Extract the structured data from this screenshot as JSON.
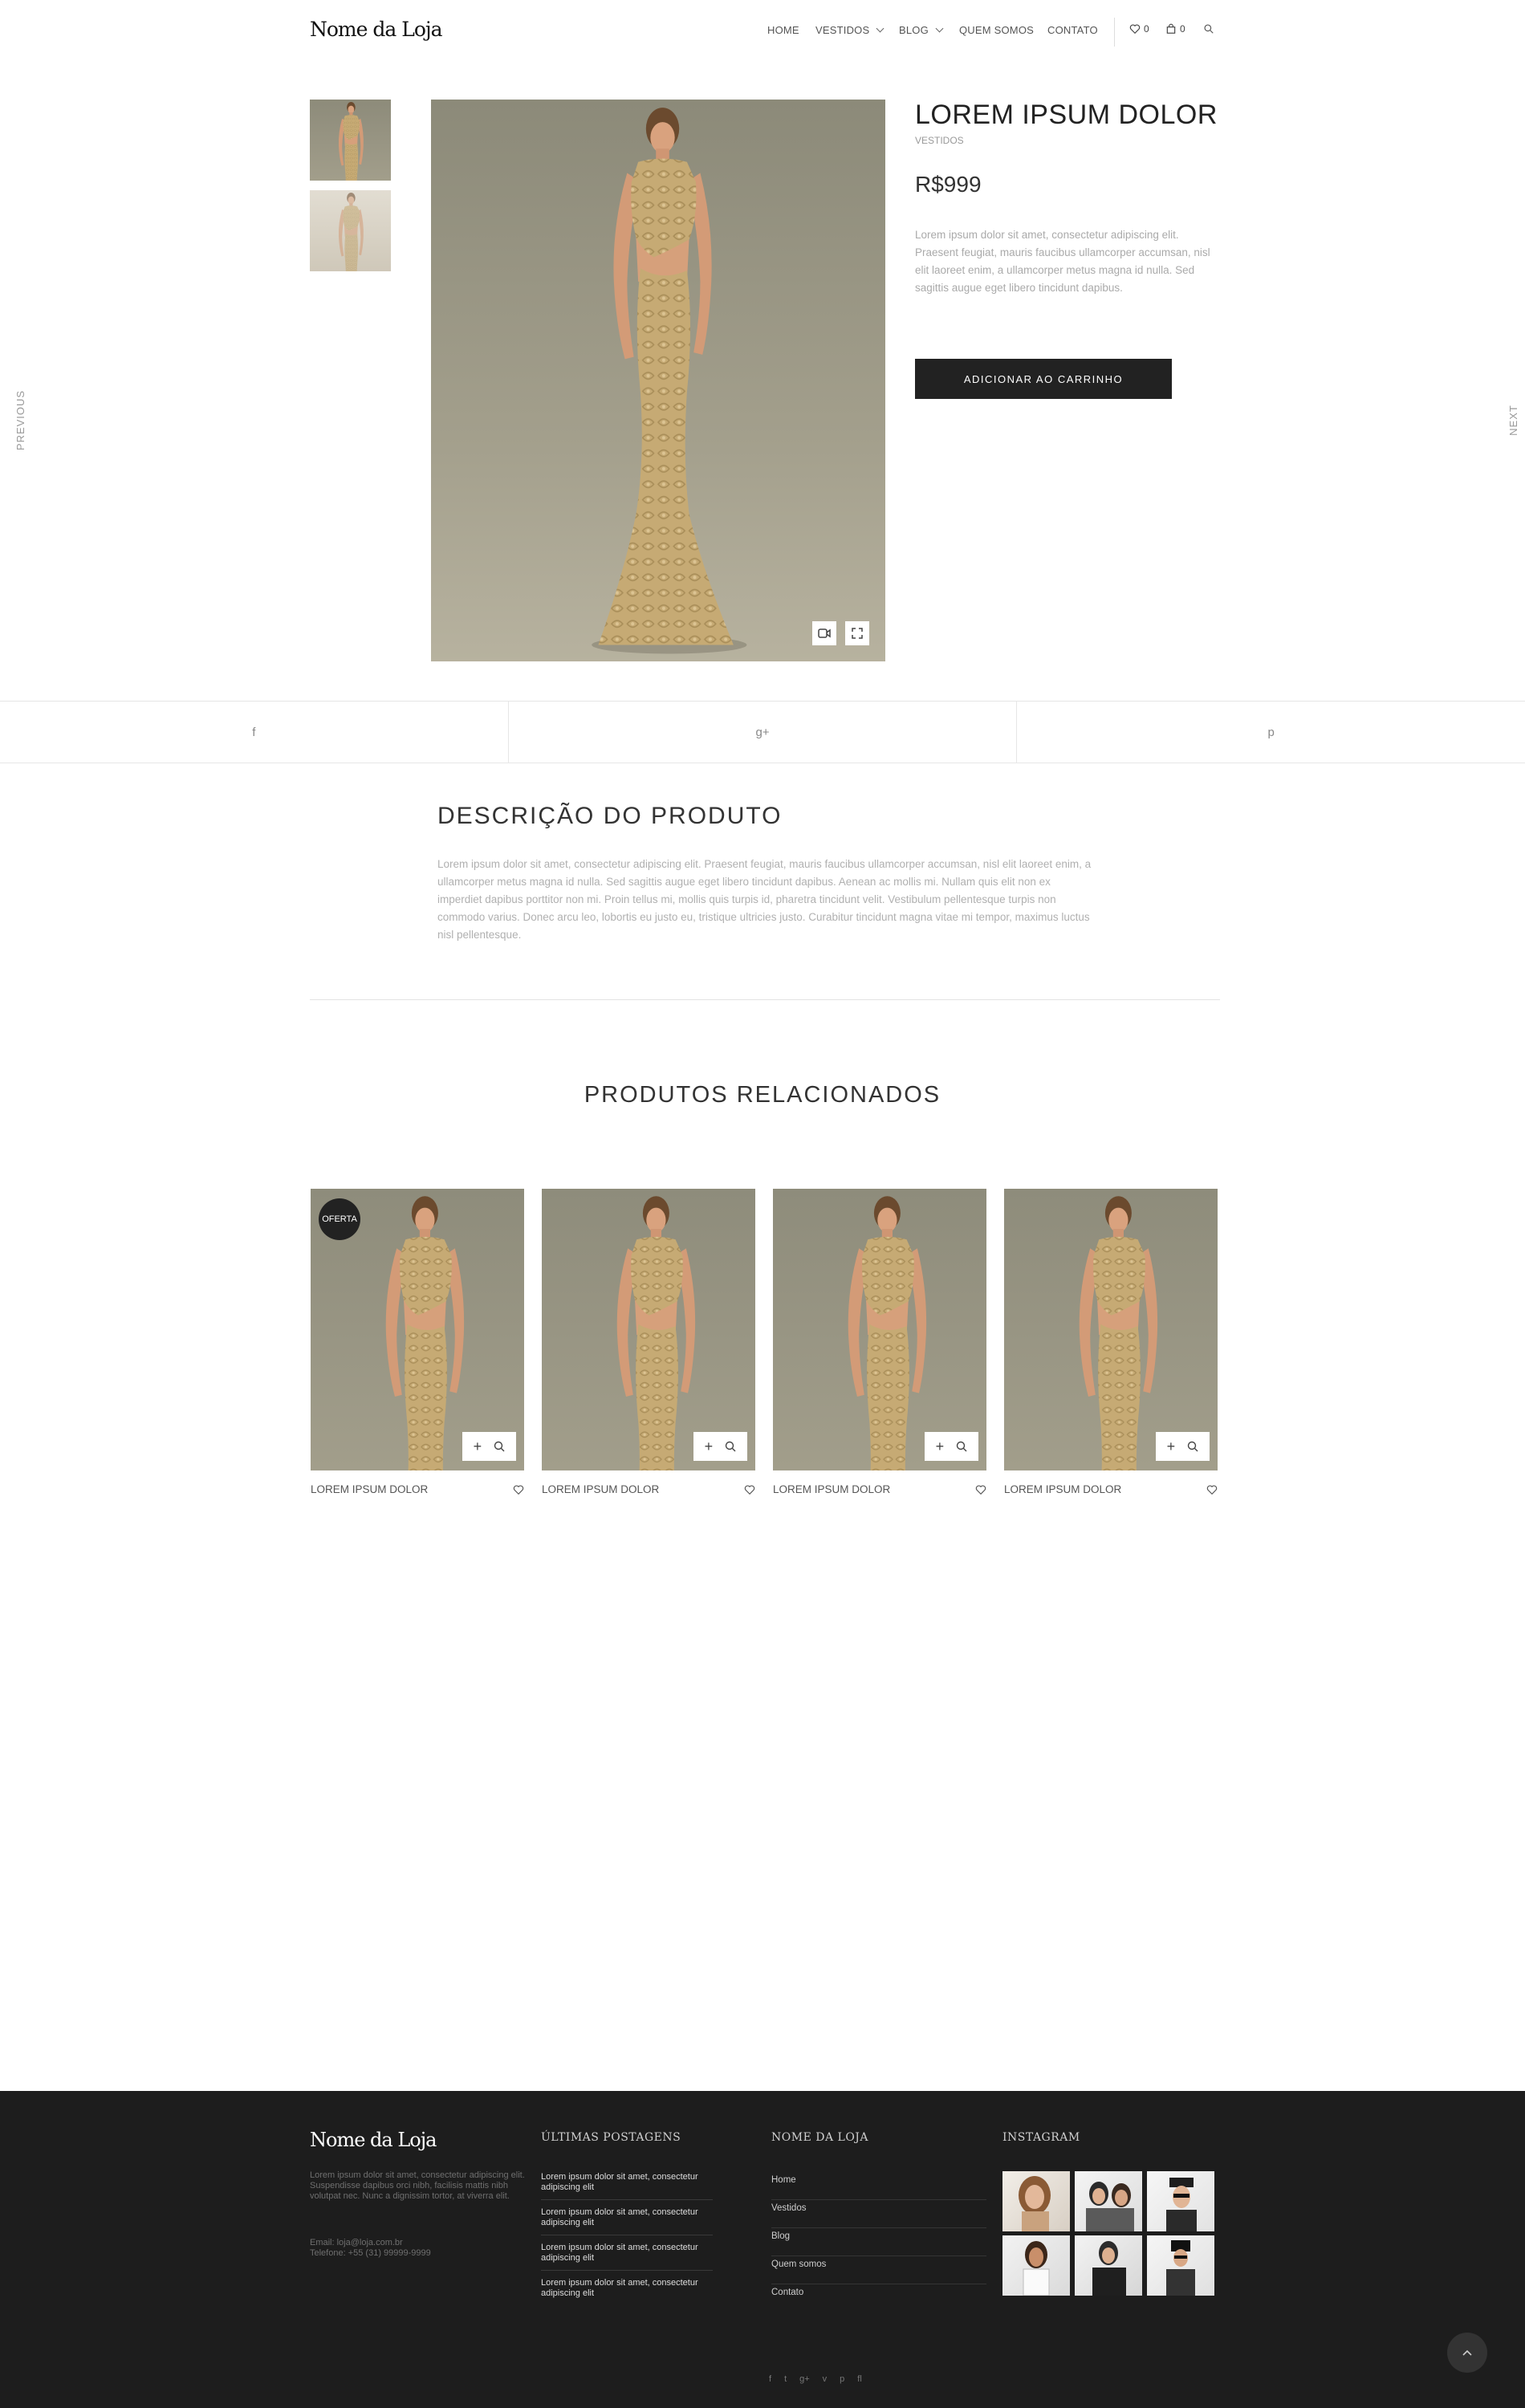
{
  "header": {
    "logo": "Nome da Loja",
    "nav": {
      "home": "HOME",
      "vestidos": "VESTIDOS",
      "blog": "BLOG",
      "quem_somos": "QUEM SOMOS",
      "contato": "CONTATO"
    },
    "wishlist_count": "0",
    "cart_count": "0"
  },
  "side_nav": {
    "previous": "PREVIOUS",
    "next": "NEXT"
  },
  "product": {
    "title": "LOREM IPSUM DOLOR",
    "category": "VESTIDOS",
    "price": "R$999",
    "short_description": "Lorem ipsum dolor sit amet, consectetur adipiscing elit. Praesent feugiat, mauris faucibus ullamcorper accumsan, nisl elit laoreet enim, a ullamcorper metus magna id nulla. Sed sagittis augue eget libero tincidunt dapibus.",
    "add_to_cart": "ADICIONAR AO CARRINHO"
  },
  "share": {
    "facebook": "f",
    "google": "g+",
    "pinterest": "p"
  },
  "description": {
    "title": "DESCRIÇÃO DO PRODUTO",
    "text": "Lorem ipsum dolor sit amet, consectetur adipiscing elit. Praesent feugiat, mauris faucibus ullamcorper accumsan, nisl elit laoreet enim, a ullamcorper metus magna id nulla. Sed sagittis augue eget libero tincidunt dapibus. Aenean ac mollis mi. Nullam quis elit non ex imperdiet dapibus porttitor non mi. Proin tellus mi, mollis quis turpis id, pharetra tincidunt velit. Vestibulum pellentesque turpis non commodo varius. Donec arcu leo, lobortis eu justo eu, tristique ultricies justo. Curabitur tincidunt magna vitae mi tempor, maximus luctus nisl pellentesque."
  },
  "related": {
    "title": "PRODUTOS RELACIONADOS",
    "badge": "OFERTA",
    "items": [
      {
        "name": "LOREM IPSUM DOLOR"
      },
      {
        "name": "LOREM IPSUM DOLOR"
      },
      {
        "name": "LOREM IPSUM DOLOR"
      },
      {
        "name": "LOREM IPSUM DOLOR"
      }
    ]
  },
  "footer": {
    "logo": "Nome da Loja",
    "about": "Lorem ipsum dolor sit amet, consectetur adipiscing elit. Suspendisse dapibus orci nibh, facilisis mattis nibh volutpat nec. Nunc a dignissim tortor, at viverra elit.",
    "email": "Email: loja@loja.com.br",
    "phone": "Telefone: +55 (31) 99999-9999",
    "posts_title": "ÚLTIMAS POSTAGENS",
    "posts": [
      "Lorem ipsum dolor sit amet, consectetur adipiscing elit",
      "Lorem ipsum dolor sit amet, consectetur adipiscing elit",
      "Lorem ipsum dolor sit amet, consectetur adipiscing elit",
      "Lorem ipsum dolor sit amet, consectetur adipiscing elit"
    ],
    "store_title": "NOME DA LOJA",
    "links": [
      "Home",
      "Vestidos",
      "Blog",
      "Quem somos",
      "Contato"
    ],
    "instagram_title": "INSTAGRAM",
    "social": [
      "f",
      "t",
      "g+",
      "v",
      "p",
      "fl"
    ]
  },
  "colors": {
    "dark": "#222222",
    "footer_bg": "#1d1d1d",
    "muted_text": "#aaaaaa",
    "dress_gold": "#c8ad78",
    "image_bg": "#9c9886"
  }
}
